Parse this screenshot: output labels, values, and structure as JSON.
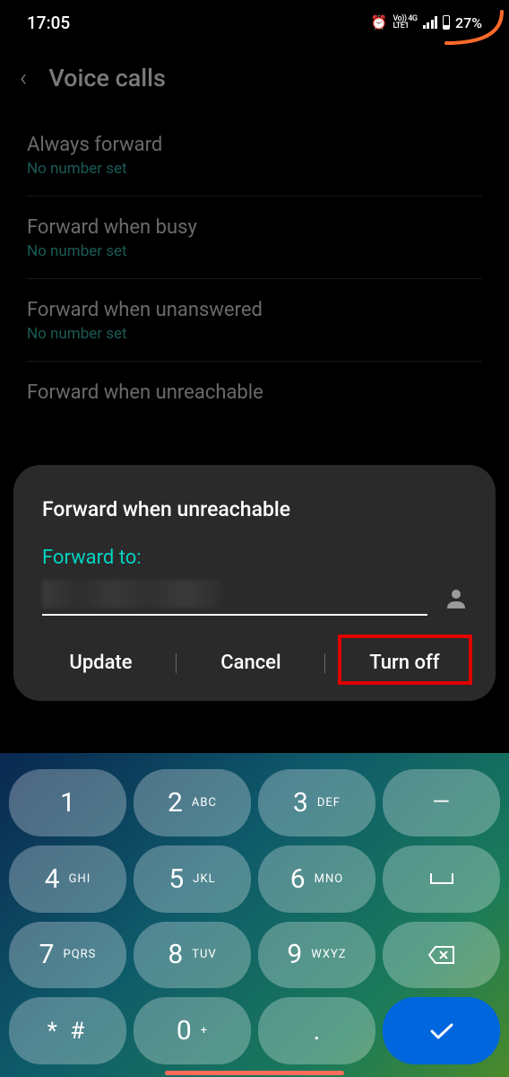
{
  "status_bar": {
    "time": "17:05",
    "alarm_icon": "alarm",
    "network_label_top": "Vo)) 4G",
    "network_label_bottom": "LTE1",
    "battery_percent": "27%"
  },
  "header": {
    "back_icon": "‹",
    "title": "Voice calls"
  },
  "settings": [
    {
      "title": "Always forward",
      "subtitle": "No number set"
    },
    {
      "title": "Forward when busy",
      "subtitle": "No number set"
    },
    {
      "title": "Forward when unanswered",
      "subtitle": "No number set"
    },
    {
      "title": "Forward when unreachable",
      "subtitle": ""
    }
  ],
  "dialog": {
    "title": "Forward when unreachable",
    "label": "Forward to:",
    "input_value": "",
    "buttons": {
      "update": "Update",
      "cancel": "Cancel",
      "turnoff": "Turn off"
    }
  },
  "keypad": {
    "rows": [
      [
        {
          "num": "1",
          "letters": ""
        },
        {
          "num": "2",
          "letters": "ABC"
        },
        {
          "num": "3",
          "letters": "DEF"
        },
        {
          "num": "–",
          "letters": "",
          "type": "minus"
        }
      ],
      [
        {
          "num": "4",
          "letters": "GHI"
        },
        {
          "num": "5",
          "letters": "JKL"
        },
        {
          "num": "6",
          "letters": "MNO"
        },
        {
          "num": "",
          "letters": "",
          "type": "space"
        }
      ],
      [
        {
          "num": "7",
          "letters": "PQRS"
        },
        {
          "num": "8",
          "letters": "TUV"
        },
        {
          "num": "9",
          "letters": "WXYZ"
        },
        {
          "num": "",
          "letters": "",
          "type": "backspace"
        }
      ],
      [
        {
          "num": "* #",
          "letters": "",
          "type": "special"
        },
        {
          "num": "0",
          "letters": "+"
        },
        {
          "num": ".",
          "letters": ""
        },
        {
          "num": "",
          "letters": "",
          "type": "enter"
        }
      ]
    ]
  }
}
